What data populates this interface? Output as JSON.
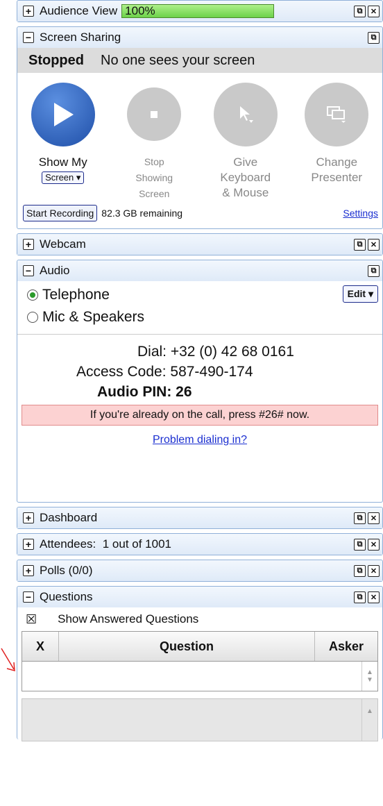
{
  "audience_view": {
    "title": "Audience View",
    "progress_label": "100%",
    "progress_value": 1.0
  },
  "screen_sharing": {
    "title": "Screen Sharing",
    "status_state": "Stopped",
    "status_message": "No one sees your screen",
    "controls": [
      {
        "line1": "Show My",
        "dropdown": "Screen ▾"
      },
      {
        "line1": "Stop",
        "line2": "Showing",
        "line3": "Screen"
      },
      {
        "line1": "Give",
        "line2": "Keyboard",
        "line3": "& Mouse"
      },
      {
        "line1": "Change",
        "line2": "Presenter"
      }
    ],
    "start_recording": "Start Recording",
    "remaining": "82.3 GB remaining",
    "settings_link": "Settings"
  },
  "webcam": {
    "title": "Webcam"
  },
  "audio": {
    "title": "Audio",
    "option_telephone": "Telephone",
    "option_mic": "Mic & Speakers",
    "edit_button": "Edit ▾",
    "dial": "Dial: +32 (0) 42 68 0161",
    "access_code": "Access Code: 587-490-174",
    "audio_pin": "Audio PIN: 26",
    "notice": "If you're already on the call, press #26# now.",
    "problem_link": "Problem dialing in?"
  },
  "dashboard": {
    "title": "Dashboard"
  },
  "attendees": {
    "title": "Attendees:  1 out of 1001"
  },
  "polls": {
    "title": "Polls (0/0)"
  },
  "questions": {
    "title": "Questions",
    "show_answered": "Show Answered Questions",
    "columns": [
      "X",
      "Question",
      "Asker"
    ]
  },
  "icons": {
    "expand": "+",
    "collapse": "−",
    "popout": "⧉",
    "close": "✕",
    "checkbox_x": "☒"
  },
  "colors": {
    "accent_blue": "#1f4fa8",
    "panel_border": "#8fb0d8",
    "notice_bg": "#fcd2d2",
    "annotation_arrow": "#e02020"
  }
}
